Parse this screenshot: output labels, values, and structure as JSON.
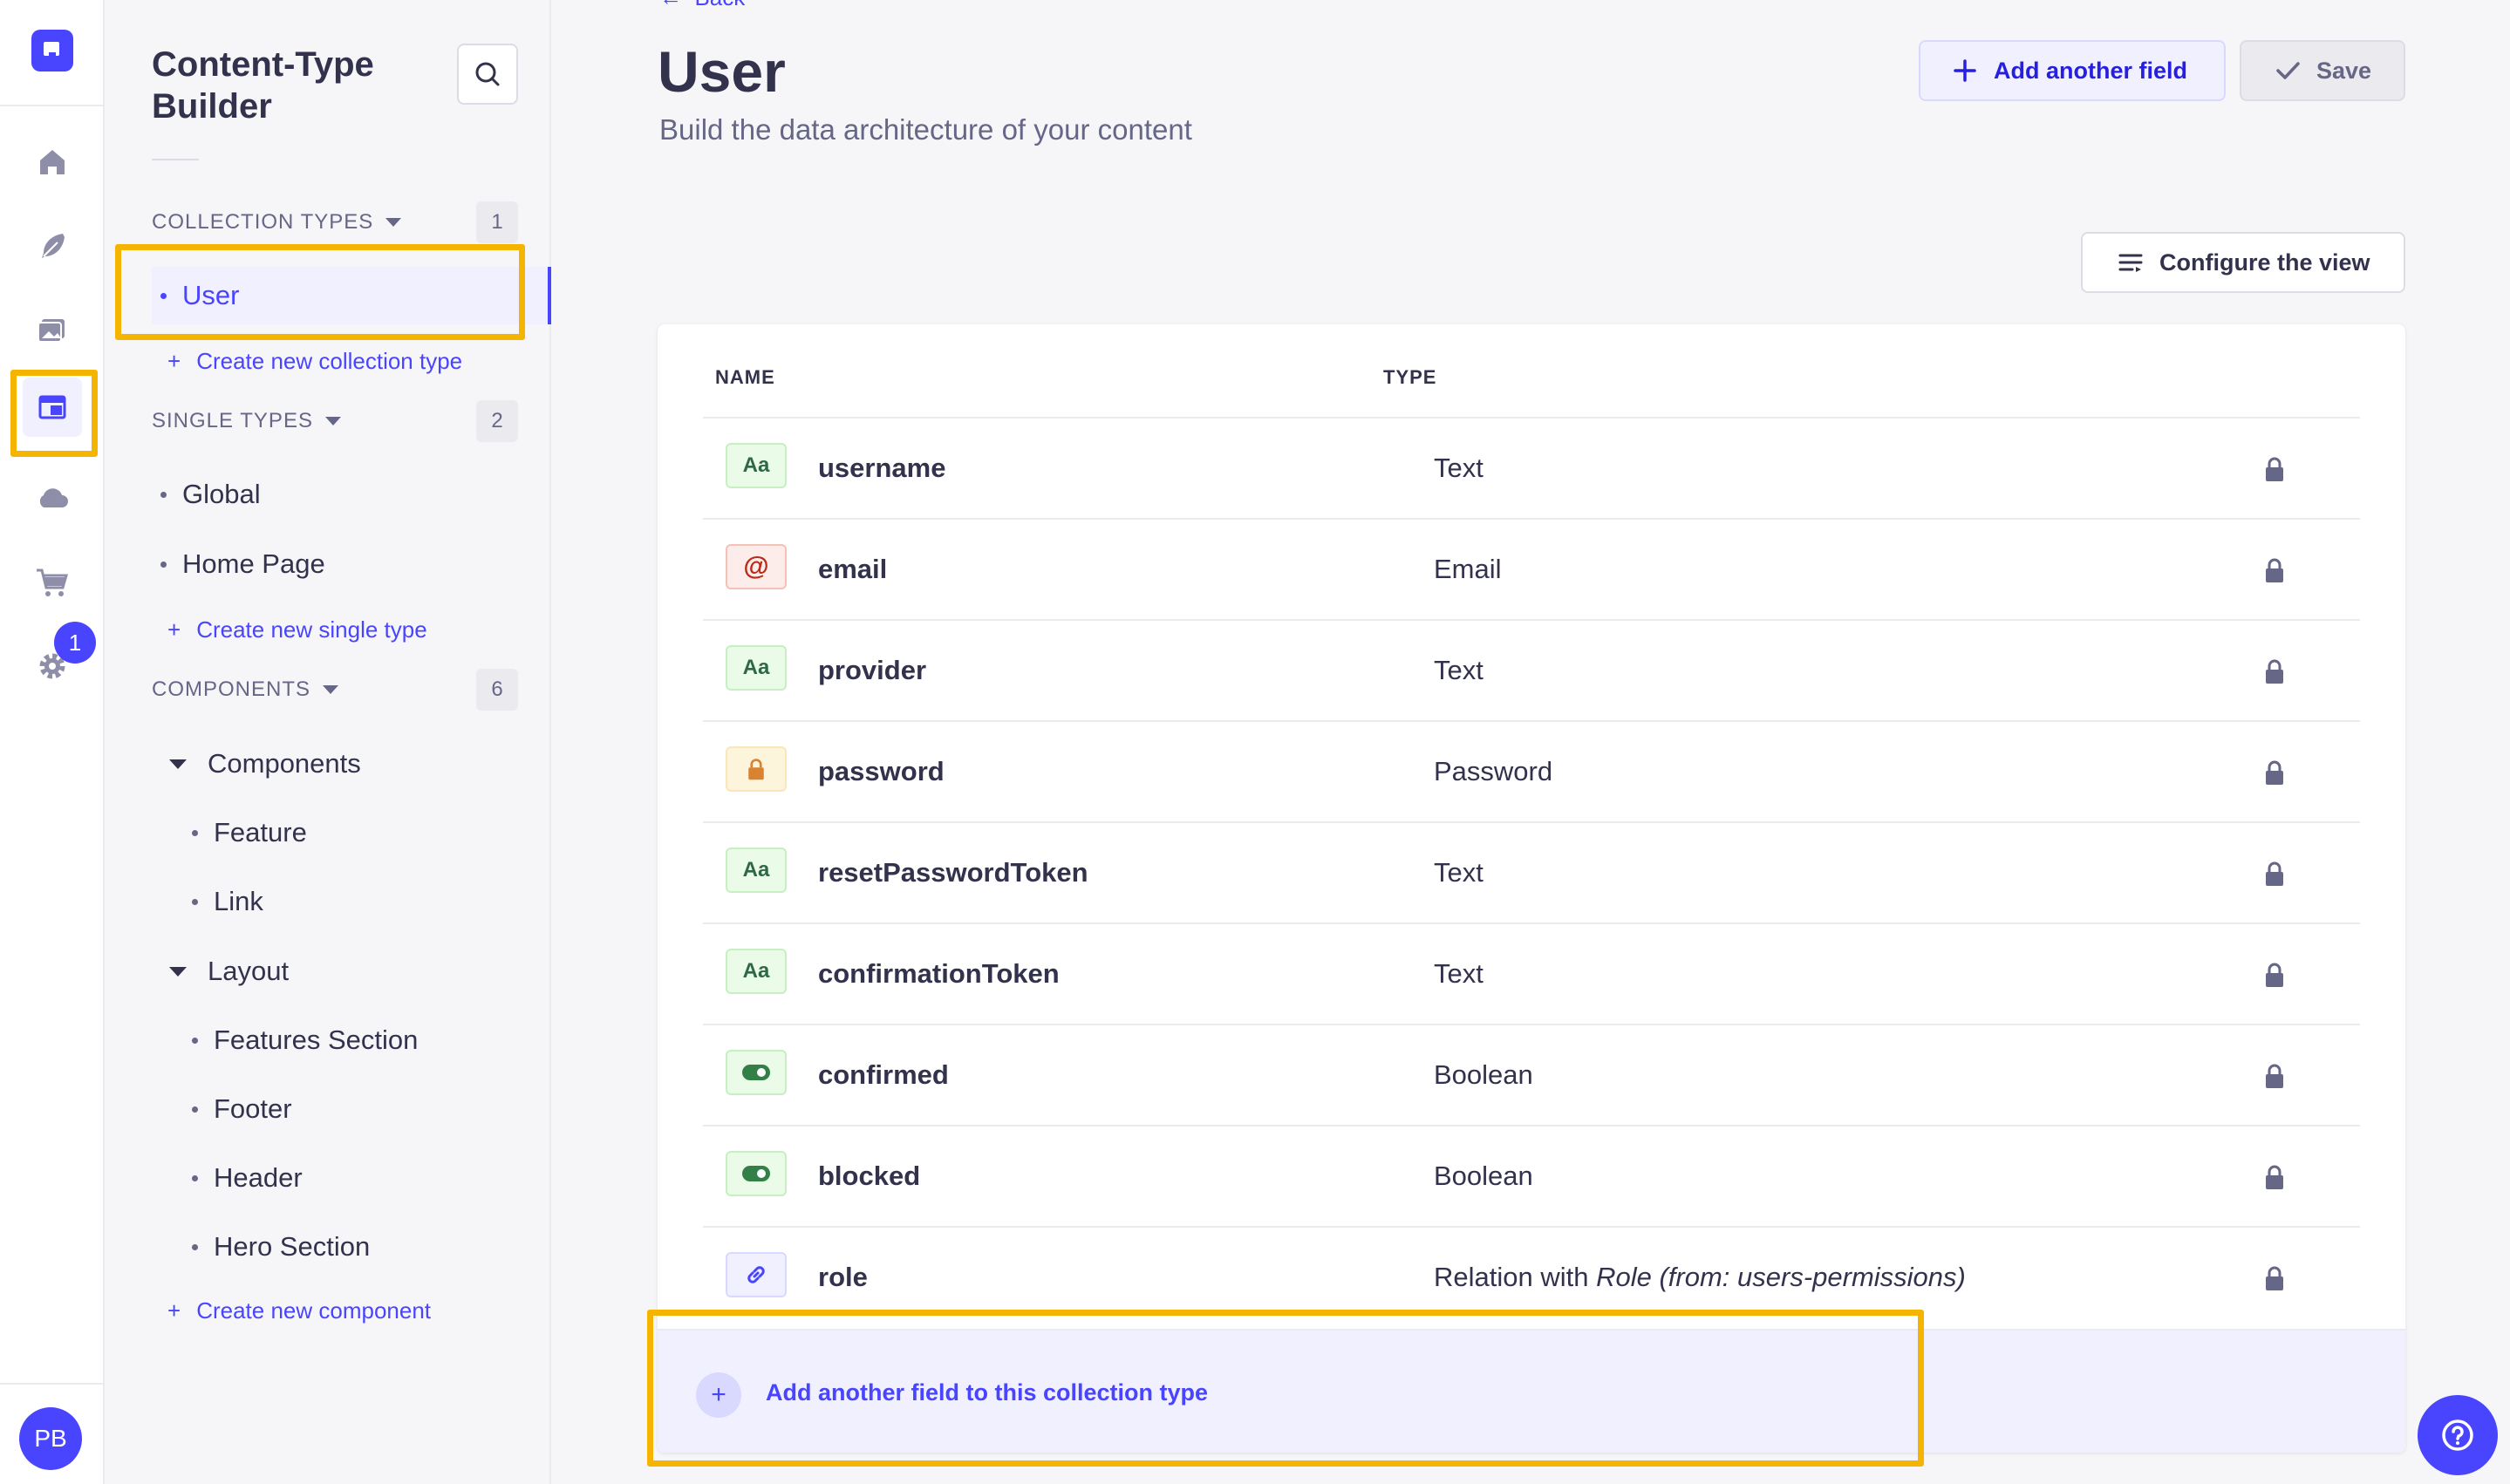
{
  "rail": {
    "icons": [
      "logo-icon",
      "home-icon",
      "feather-icon",
      "media-icon",
      "content-type-builder-icon",
      "cloud-icon",
      "cart-icon",
      "settings-icon"
    ],
    "settings_badge": "1",
    "avatar_initials": "PB"
  },
  "subnav": {
    "title": "Content-Type Builder",
    "collection_types": {
      "label": "COLLECTION TYPES",
      "count": "1",
      "items": [
        "User"
      ],
      "create_label": "Create new collection type"
    },
    "single_types": {
      "label": "SINGLE TYPES",
      "count": "2",
      "items": [
        "Global",
        "Home Page"
      ],
      "create_label": "Create new single type"
    },
    "components": {
      "label": "COMPONENTS",
      "count": "6",
      "groups": [
        {
          "name": "Components",
          "items": [
            "Feature",
            "Link"
          ]
        },
        {
          "name": "Layout",
          "items": [
            "Features Section",
            "Footer",
            "Header",
            "Hero Section"
          ]
        }
      ],
      "create_label": "Create new component"
    }
  },
  "header": {
    "back_label": "Back",
    "title": "User",
    "subtitle": "Build the data architecture of your content",
    "add_field_label": "Add another field",
    "save_label": "Save",
    "configure_label": "Configure the view"
  },
  "table": {
    "columns": [
      "NAME",
      "TYPE"
    ],
    "rows": [
      {
        "name": "username",
        "type": "Text",
        "icon": "text"
      },
      {
        "name": "email",
        "type": "Email",
        "icon": "email"
      },
      {
        "name": "provider",
        "type": "Text",
        "icon": "text"
      },
      {
        "name": "password",
        "type": "Password",
        "icon": "password"
      },
      {
        "name": "resetPasswordToken",
        "type": "Text",
        "icon": "text"
      },
      {
        "name": "confirmationToken",
        "type": "Text",
        "icon": "text"
      },
      {
        "name": "confirmed",
        "type": "Boolean",
        "icon": "boolean"
      },
      {
        "name": "blocked",
        "type": "Boolean",
        "icon": "boolean"
      },
      {
        "name": "role",
        "type_prefix": "Relation with ",
        "type_target": "Role (from: users-permissions)",
        "icon": "relation"
      }
    ],
    "add_footer_label": "Add another field to this collection type"
  },
  "colors": {
    "primary": "#4945ff",
    "highlight": "#f5b400",
    "text": "#32324d",
    "muted": "#666687"
  }
}
